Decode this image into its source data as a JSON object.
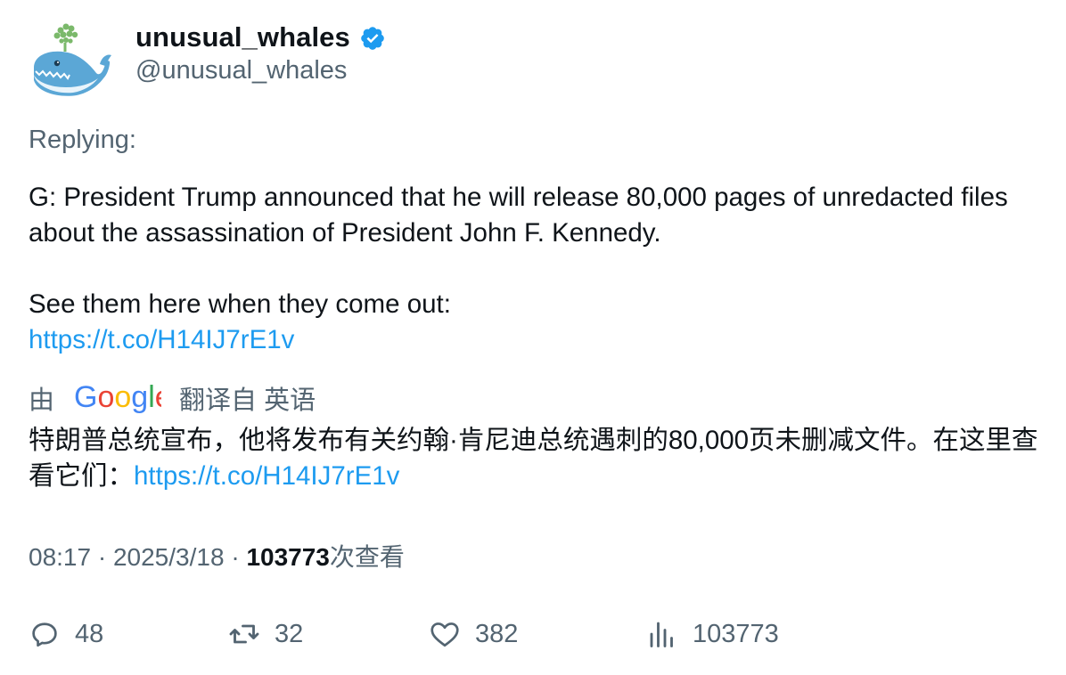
{
  "author": {
    "display_name": "unusual_whales",
    "handle": "@unusual_whales",
    "verified": true
  },
  "replying_label": "Replying:",
  "tweet": {
    "line1": "G: President Trump announced that he will release 80,000 pages of unredacted files about the assassination of President John F. Kennedy.",
    "line2": "See them here when they come out:",
    "link": "https://t.co/H14IJ7rE1v"
  },
  "translation": {
    "prefix": "由",
    "brand": "Google",
    "suffix": "翻译自 英语",
    "text": "特朗普总统宣布，他将发布有关约翰·肯尼迪总统遇刺的80,000页未删减文件。在这里查看它们：",
    "link": "https://t.co/H14IJ7rE1v"
  },
  "meta": {
    "time": "08:17",
    "separator": " · ",
    "date": "2025/3/18",
    "views": "103773",
    "views_label": "次查看"
  },
  "actions": {
    "replies": "48",
    "retweets": "32",
    "likes": "382",
    "views": "103773"
  },
  "colors": {
    "accent": "#1d9bf0",
    "secondary_text": "#536471",
    "primary_text": "#0f1419"
  }
}
